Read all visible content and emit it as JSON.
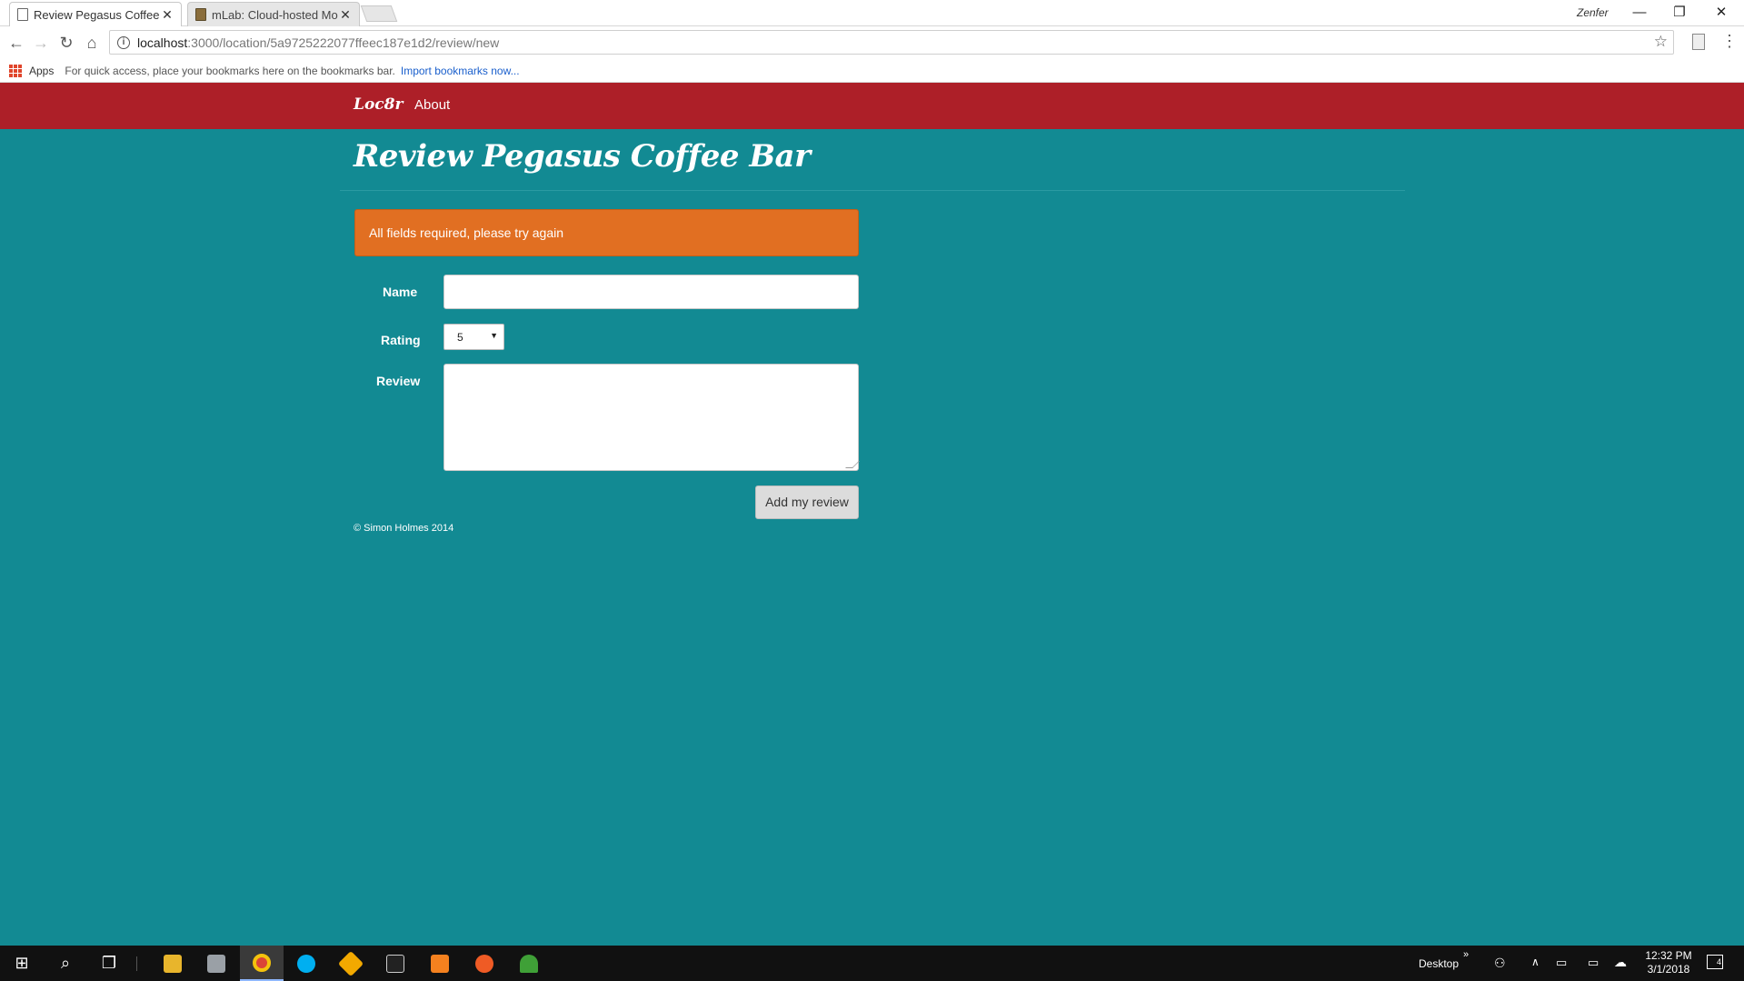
{
  "browser": {
    "tabs": [
      {
        "title": "Review Pegasus Coffee B",
        "active": true
      },
      {
        "title": "mLab: Cloud-hosted Mo",
        "active": false
      }
    ],
    "profile_name": "Zenfer",
    "url_host": "localhost",
    "url_path": ":3000/location/5a9725222077ffeec187e1d2/review/new",
    "bookmarks": {
      "apps_label": "Apps",
      "hint_text": "For quick access, place your bookmarks here on the bookmarks bar.",
      "import_link": "Import bookmarks now..."
    }
  },
  "site": {
    "brand": "Loc8r",
    "nav_about": "About",
    "page_title": "Review Pegasus Coffee Bar",
    "alert": "All fields required, please try again",
    "form": {
      "name_label": "Name",
      "name_value": "",
      "rating_label": "Rating",
      "rating_value": "5",
      "review_label": "Review",
      "review_value": "",
      "submit_label": "Add my review"
    },
    "footer": "© Simon Holmes 2014"
  },
  "taskbar": {
    "desktop_label": "Desktop",
    "time": "12:32 PM",
    "date": "3/1/2018",
    "notification_count": "4"
  },
  "colors": {
    "page_bg": "#128a93",
    "navbar_bg": "#ad1f28",
    "alert_bg": "#e16f22"
  }
}
